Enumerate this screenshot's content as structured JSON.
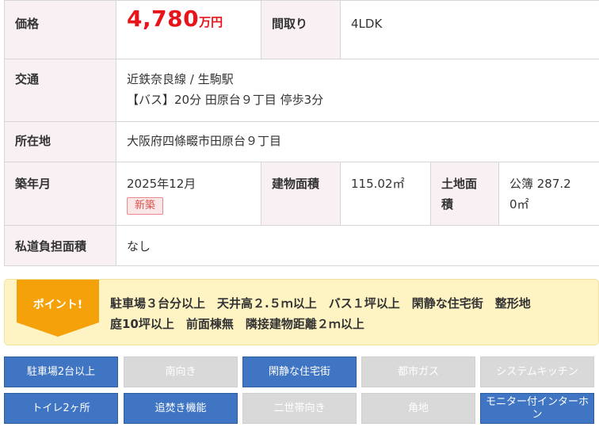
{
  "spec": {
    "price_label": "価格",
    "price_value": "4,780",
    "price_unit": "万円",
    "layout_label": "間取り",
    "layout_value": "4LDK",
    "access_label": "交通",
    "access_line1": "近鉄奈良線 / 生駒駅",
    "access_line2": "【バス】20分 田原台９丁目 停歩3分",
    "address_label": "所在地",
    "address_value": "大阪府四條畷市田原台９丁目",
    "built_label": "築年月",
    "built_value": "2025年12月",
    "built_badge": "新築",
    "building_area_label": "建物面積",
    "building_area_value": "115.02㎡",
    "land_area_label_1": "土地面",
    "land_area_label_2": "積",
    "land_area_value_1": "公簿 287.2",
    "land_area_value_2": "0㎡",
    "private_road_label": "私道負担面積",
    "private_road_value": "なし"
  },
  "point": {
    "tag": "ポイント!",
    "text_line1": "駐車場３台分以上　天井高２.５ｍ以上　バス１坪以上　閑静な住宅街　整形地",
    "text_line2": "庭10坪以上　前面棟無　隣接建物距離２ｍ以上",
    "tag_color": "#f5a10a",
    "background_color": "#fdf3c3"
  },
  "features": {
    "active_color": "#3f75c3",
    "inactive_color": "#d9d9d9",
    "items": [
      {
        "label": "駐車場2台以上",
        "active": true
      },
      {
        "label": "南向き",
        "active": false
      },
      {
        "label": "閑静な住宅街",
        "active": true
      },
      {
        "label": "都市ガス",
        "active": false
      },
      {
        "label": "システムキッチン",
        "active": false
      },
      {
        "label": "トイレ2ヶ所",
        "active": true
      },
      {
        "label": "追焚き機能",
        "active": true
      },
      {
        "label": "二世帯向き",
        "active": false
      },
      {
        "label": "角地",
        "active": false
      },
      {
        "label": "モニター付インターホン",
        "active": true
      }
    ]
  }
}
